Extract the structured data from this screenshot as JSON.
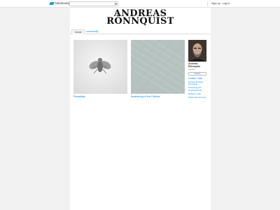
{
  "topbar": {
    "logo_text": "bandcamp",
    "search_placeholder": "Search for artist, album, or track",
    "signup_label": "Sign up",
    "login_label": "Log in"
  },
  "masthead": {
    "line1": "ANDREAS",
    "line2": "RÖNNQUIST"
  },
  "tabs": [
    {
      "label": "music"
    },
    {
      "label": "community"
    }
  ],
  "releases": [
    {
      "title": "Parasitata",
      "cover_icon": "fly-ornament-icon"
    },
    {
      "title": "Awakening of the Fathers",
      "cover_icon": "fabric-texture-icon"
    }
  ],
  "sidebar": {
    "artist_name": "Andreas Rönnquist",
    "location": "Sweden",
    "follow_label": "Follow",
    "contact_label": "contact / help",
    "links": [
      "Contact Andreas Rönnquist",
      "Streaming and Download help",
      "Redeem code",
      "Report this account"
    ]
  },
  "colors": {
    "link": "#0687f5",
    "logo": "#1da0c3",
    "background": "#f2f2f2"
  }
}
